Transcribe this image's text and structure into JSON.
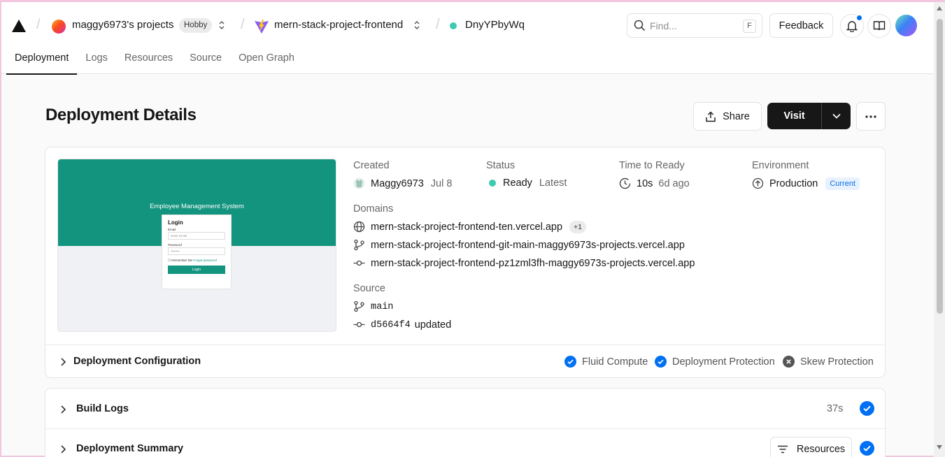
{
  "header": {
    "team_name": "maggy6973's projects",
    "plan_badge": "Hobby",
    "project_name": "mern-stack-project-frontend",
    "deployment_id": "DnyYPbyWq",
    "search_placeholder": "Find...",
    "search_shortcut": "F",
    "feedback_label": "Feedback"
  },
  "tabs": [
    {
      "label": "Deployment",
      "active": true
    },
    {
      "label": "Logs"
    },
    {
      "label": "Resources"
    },
    {
      "label": "Source"
    },
    {
      "label": "Open Graph"
    }
  ],
  "page": {
    "title": "Deployment Details",
    "share_label": "Share",
    "visit_label": "Visit"
  },
  "preview": {
    "app_title": "Employee Management System",
    "login_heading": "Login",
    "email_label": "Email",
    "email_placeholder": "Enter Email",
    "password_label": "Password",
    "password_value": "••••••••",
    "remember_label": "Remember Me",
    "forgot_label": "Forgot password",
    "login_button": "Login"
  },
  "details": {
    "created_label": "Created",
    "creator": "Maggy6973",
    "created_date": "Jul 8",
    "status_label": "Status",
    "status_value": "Ready",
    "status_tag": "Latest",
    "time_label": "Time to Ready",
    "time_value": "10s",
    "time_ago": "6d ago",
    "env_label": "Environment",
    "env_value": "Production",
    "env_badge": "Current",
    "domains_label": "Domains",
    "domains": [
      "mern-stack-project-frontend-ten.vercel.app",
      "mern-stack-project-frontend-git-main-maggy6973s-projects.vercel.app",
      "mern-stack-project-frontend-pz1zml3fh-maggy6973s-projects.vercel.app"
    ],
    "domains_extra": "+1",
    "source_label": "Source",
    "branch": "main",
    "commit_hash": "d5664f4",
    "commit_message": "updated"
  },
  "config": {
    "title": "Deployment Configuration",
    "features": [
      {
        "label": "Fluid Compute",
        "enabled": true
      },
      {
        "label": "Deployment Protection",
        "enabled": true
      },
      {
        "label": "Skew Protection",
        "enabled": false
      }
    ]
  },
  "build": {
    "title": "Build Logs",
    "duration": "37s"
  },
  "summary": {
    "title": "Deployment Summary",
    "resources_label": "Resources"
  },
  "colors": {
    "accent_blue": "#0070f3",
    "status_ready": "#3ec9b0",
    "preview_teal": "#12947f"
  }
}
